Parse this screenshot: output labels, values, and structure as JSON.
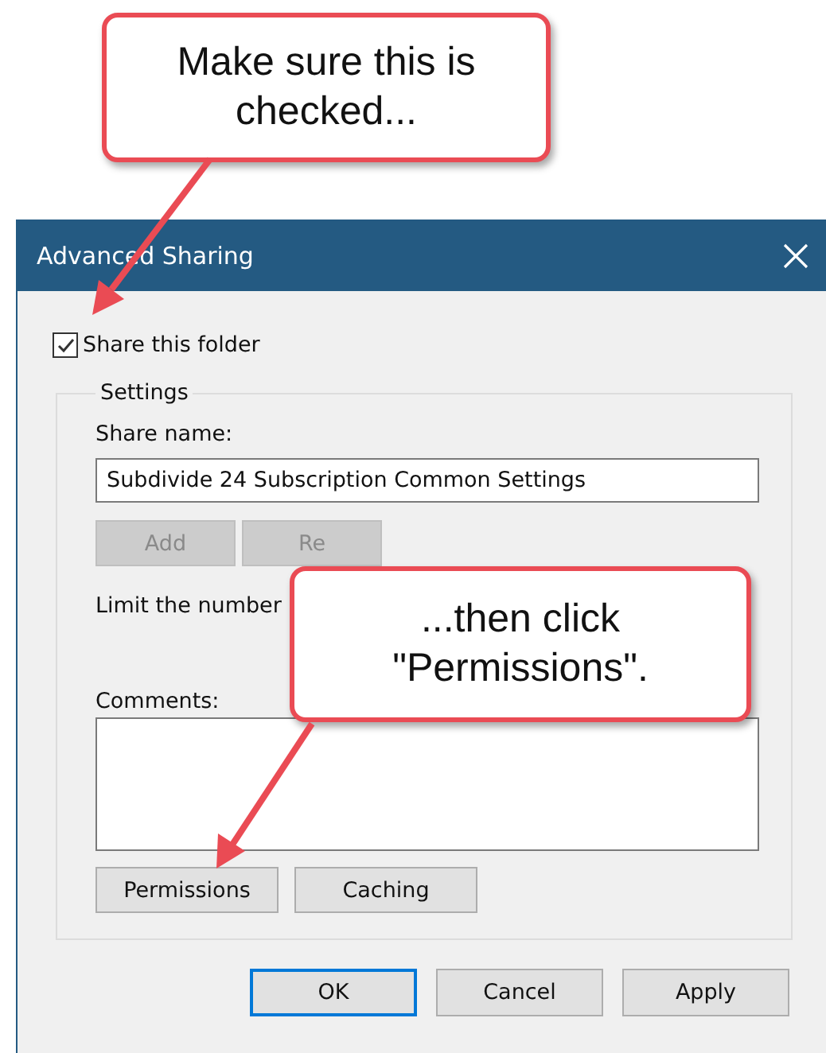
{
  "callouts": [
    {
      "lines": [
        "Make sure this is",
        "checked..."
      ]
    },
    {
      "lines": [
        "...then click",
        "\"Permissions\"."
      ]
    }
  ],
  "window": {
    "title": "Advanced Sharing"
  },
  "share_checkbox": {
    "label": "Share this folder",
    "checked": true
  },
  "settings": {
    "title": "Settings",
    "share_name_label": "Share name:",
    "share_name_value": "Subdivide 24 Subscription Common Settings",
    "user_buttons": [
      {
        "label": "Add",
        "disabled": true
      },
      {
        "label": "Re",
        "disabled": true
      }
    ],
    "limit_text": "Limit the number",
    "comments_label": "Comments:",
    "buttons": [
      {
        "label": "Permissions",
        "disabled": false
      },
      {
        "label": "Caching",
        "disabled": false
      }
    ]
  },
  "footer_buttons": [
    {
      "label": "OK",
      "default": true
    },
    {
      "label": "Cancel",
      "default": false
    },
    {
      "label": "Apply",
      "default": false
    }
  ]
}
